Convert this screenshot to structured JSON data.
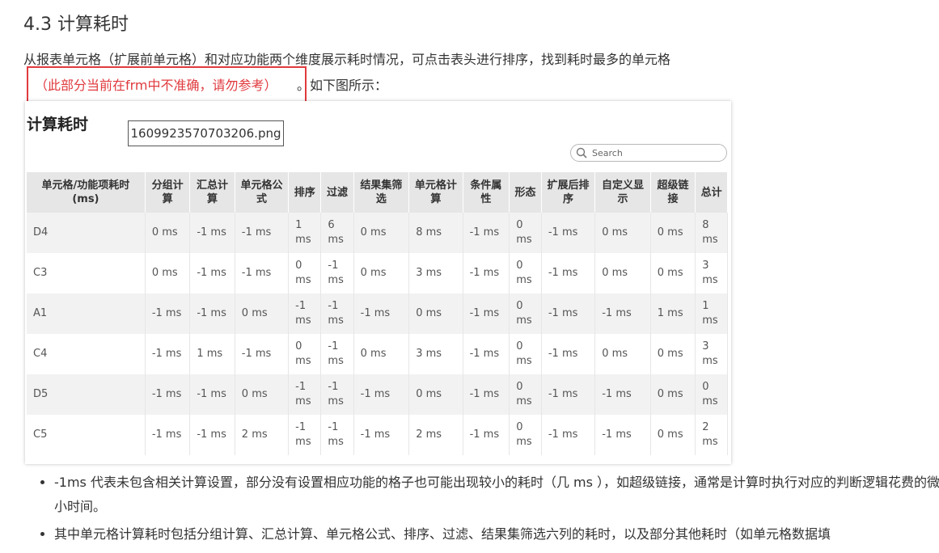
{
  "heading": "4.3 计算耗时",
  "intro": "从报表单元格（扩展前单元格）和对应功能两个维度展示耗时情况，可点击表头进行排序，找到耗时最多的单元格",
  "note": "（此部分当前在frm中不准确，请勿参考）",
  "after_note": "。如下图所示：",
  "screenshot": {
    "title": "计算耗时",
    "file_label": "1609923570703206.png",
    "search_placeholder": "Search"
  },
  "table": {
    "headers": [
      "单元格/功能项耗时(ms)",
      "分组计算",
      "汇总计算",
      "单元格公式",
      "排序",
      "过滤",
      "结果集筛选",
      "单元格计算",
      "条件属性",
      "形态",
      "扩展后排序",
      "自定义显示",
      "超级链接",
      "总计"
    ],
    "rows": [
      [
        "D4",
        "0 ms",
        "-1 ms",
        "-1 ms",
        "1 ms",
        "6 ms",
        "0 ms",
        "8 ms",
        "-1 ms",
        "0 ms",
        "-1 ms",
        "0 ms",
        "0 ms",
        "8 ms"
      ],
      [
        "C3",
        "0 ms",
        "-1 ms",
        "-1 ms",
        "0 ms",
        "-1 ms",
        "0 ms",
        "3 ms",
        "-1 ms",
        "0 ms",
        "-1 ms",
        "0 ms",
        "0 ms",
        "3 ms"
      ],
      [
        "A1",
        "-1 ms",
        "-1 ms",
        "0 ms",
        "-1 ms",
        "-1 ms",
        "-1 ms",
        "0 ms",
        "-1 ms",
        "0 ms",
        "-1 ms",
        "-1 ms",
        "1 ms",
        "1 ms"
      ],
      [
        "C4",
        "-1 ms",
        "1 ms",
        "-1 ms",
        "0 ms",
        "-1 ms",
        "0 ms",
        "3 ms",
        "-1 ms",
        "0 ms",
        "-1 ms",
        "0 ms",
        "0 ms",
        "3 ms"
      ],
      [
        "D5",
        "-1 ms",
        "-1 ms",
        "0 ms",
        "-1 ms",
        "-1 ms",
        "-1 ms",
        "0 ms",
        "-1 ms",
        "0 ms",
        "-1 ms",
        "-1 ms",
        "0 ms",
        "0 ms"
      ],
      [
        "C5",
        "-1 ms",
        "-1 ms",
        "2 ms",
        "-1 ms",
        "-1 ms",
        "-1 ms",
        "2 ms",
        "-1 ms",
        "0 ms",
        "-1 ms",
        "-1 ms",
        "0 ms",
        "2 ms"
      ]
    ]
  },
  "bullets": [
    "-1ms 代表未包含相关计算设置，部分没有设置相应功能的格子也可能出现较小的耗时（几 ms ），如超级链接，通常是计算时执行对应的判断逻辑花费的微小时间。",
    "其中单元格计算耗时包括分组计算、汇总计算、单元格公式、排序、过滤、结果集筛选六列的耗时，以及部分其他耗时（如单元格数据填"
  ]
}
